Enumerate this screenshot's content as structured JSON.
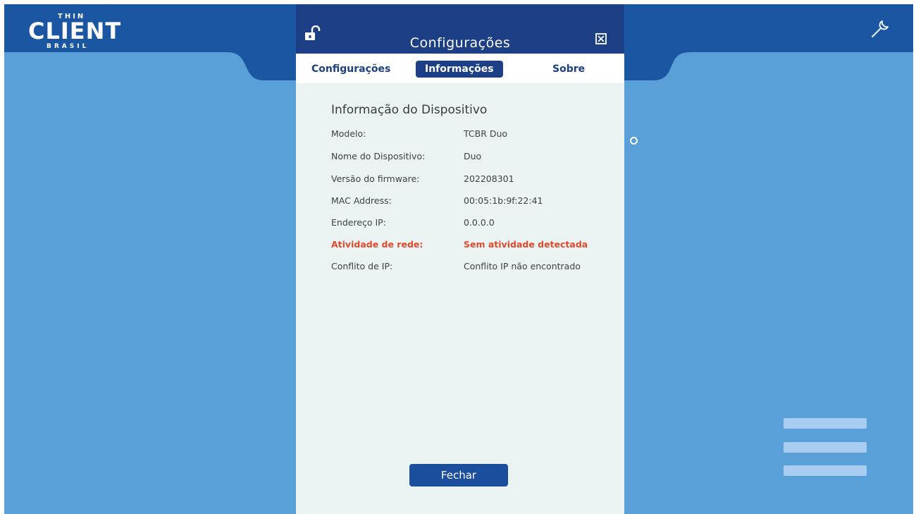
{
  "brand": {
    "logo_top": "THIN",
    "logo_main": "CLIENT",
    "logo_bottom": "BRASIL"
  },
  "icons": {
    "header_right": "wrench-icon",
    "modal_left": "unlocked-padlock-icon",
    "modal_right": "close-x-icon",
    "bottom_right": "hamburger-menu-icon"
  },
  "colors": {
    "background": "#5aa0d8",
    "header": "#1b56a3",
    "modal_header": "#1c3f86",
    "modal_body": "#eaf3f1",
    "alert": "#e14a2d",
    "menu_lines": "#a9cdf0"
  },
  "modal": {
    "title": "Configurações",
    "tabs": [
      {
        "label": "Configurações",
        "active": false
      },
      {
        "label": "Informações",
        "active": true
      },
      {
        "label": "Sobre",
        "active": false
      }
    ],
    "section_title": "Informação do Dispositivo",
    "rows": [
      {
        "label": "Modelo:",
        "value": "TCBR Duo"
      },
      {
        "label": "Nome do Dispositivo:",
        "value": "Duo"
      },
      {
        "label": "Versão do firmware:",
        "value": "202208301"
      },
      {
        "label": "MAC Address:",
        "value": "00:05:1b:9f:22:41"
      },
      {
        "label": "Endereço IP:",
        "value": "0.0.0.0"
      },
      {
        "label": "Atividade de rede:",
        "value": "Sem atividade detectada",
        "alert": true
      },
      {
        "label": "Conflito de IP:",
        "value": "Conflito IP não encontrado"
      }
    ],
    "close_label": "Fechar"
  }
}
